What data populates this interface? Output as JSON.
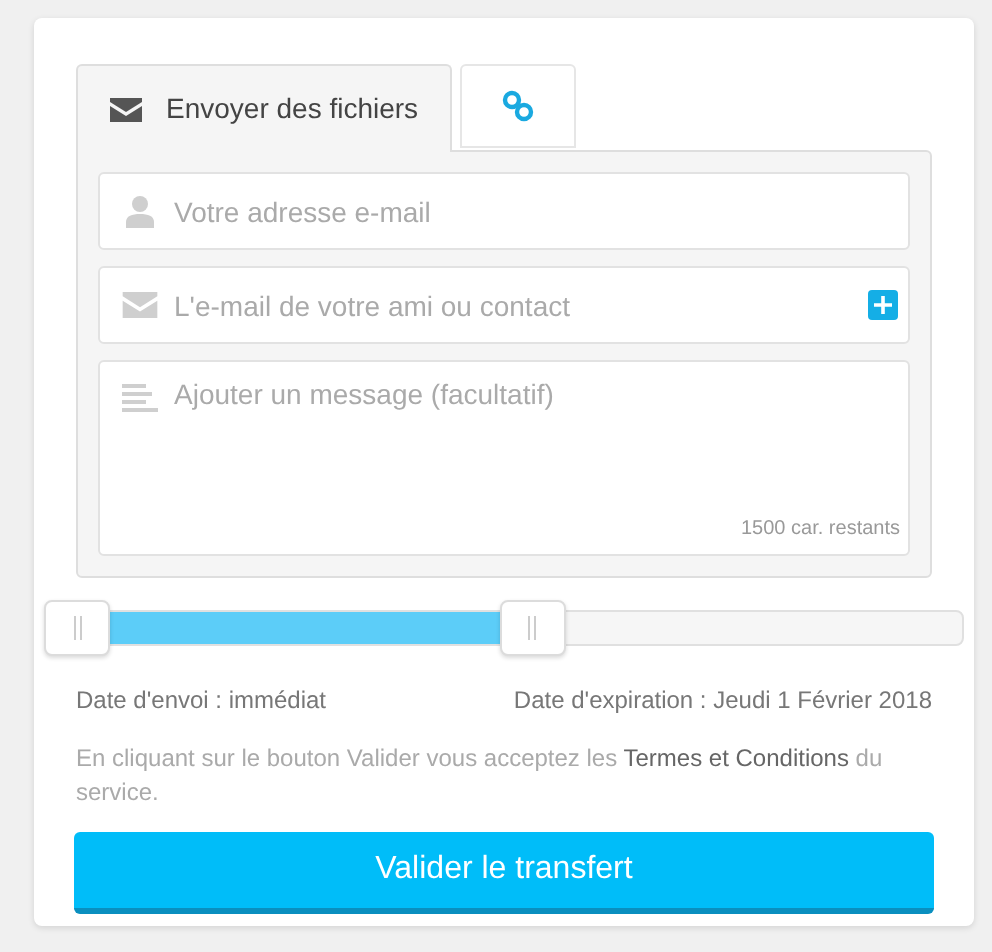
{
  "tabs": [
    {
      "kind": "mail",
      "label": "Envoyer des fichiers",
      "selected": true
    },
    {
      "kind": "link",
      "selected": false
    }
  ],
  "fields": [
    {
      "kind": "user",
      "placeholder": "Votre adresse e-mail"
    },
    {
      "kind": "mail",
      "placeholder": "L'e-mail de votre ami ou contact",
      "add_button": true
    },
    {
      "kind": "message",
      "placeholder": "Ajouter un message (facultatif)",
      "counter": "1500 car. restants"
    }
  ],
  "slider": {
    "level": 0.53
  },
  "send_date": "Date d'envoi : immédiat",
  "expiry_date": "Date d'expiration : Jeudi 1 Février 2018",
  "terms": {
    "before": "En cliquant sur le bouton Valider vous acceptez les ",
    "link": "Termes et Conditions",
    "after": " du service."
  },
  "submit": "Valider le transfert"
}
